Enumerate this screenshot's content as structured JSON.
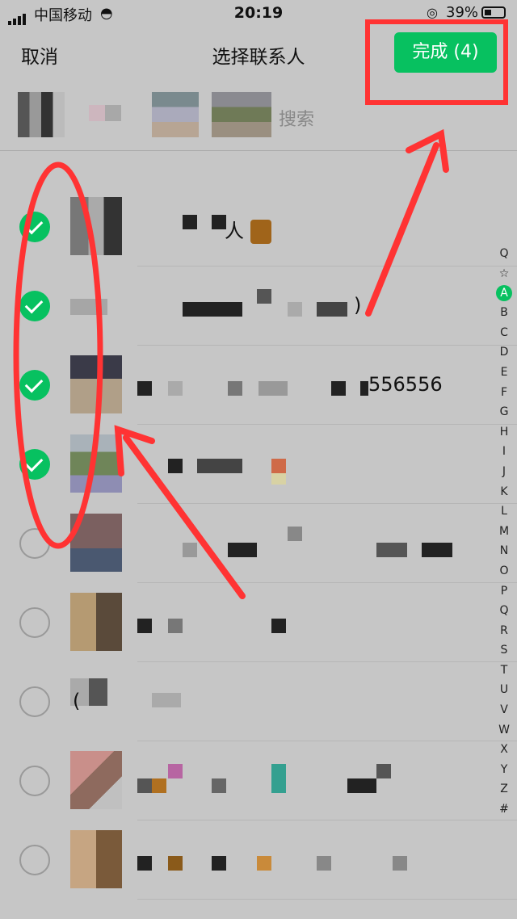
{
  "status_bar": {
    "carrier": "中国移动",
    "time": "20:19",
    "battery": "39%"
  },
  "nav": {
    "cancel_label": "取消",
    "title": "选择联系人",
    "done_label": "完成 (4)"
  },
  "search": {
    "label": "搜索"
  },
  "contacts": [
    {
      "checked": true,
      "name_suffix": "人"
    },
    {
      "checked": true,
      "name_suffix": ")"
    },
    {
      "checked": true,
      "name_suffix": "556556"
    },
    {
      "checked": true,
      "name_suffix": ""
    },
    {
      "checked": false,
      "name_suffix": ""
    },
    {
      "checked": false,
      "name_suffix": ""
    },
    {
      "checked": false,
      "name_suffix": "("
    },
    {
      "checked": false,
      "name_suffix": ""
    },
    {
      "checked": false,
      "name_suffix": ""
    }
  ],
  "index_letters": [
    "Q",
    "☆",
    "A",
    "B",
    "C",
    "D",
    "E",
    "F",
    "G",
    "H",
    "I",
    "J",
    "K",
    "L",
    "M",
    "N",
    "O",
    "P",
    "Q",
    "R",
    "S",
    "T",
    "U",
    "V",
    "W",
    "X",
    "Y",
    "Z",
    "#"
  ],
  "colors": {
    "accent": "#07c160",
    "annotation": "#ff3333"
  }
}
